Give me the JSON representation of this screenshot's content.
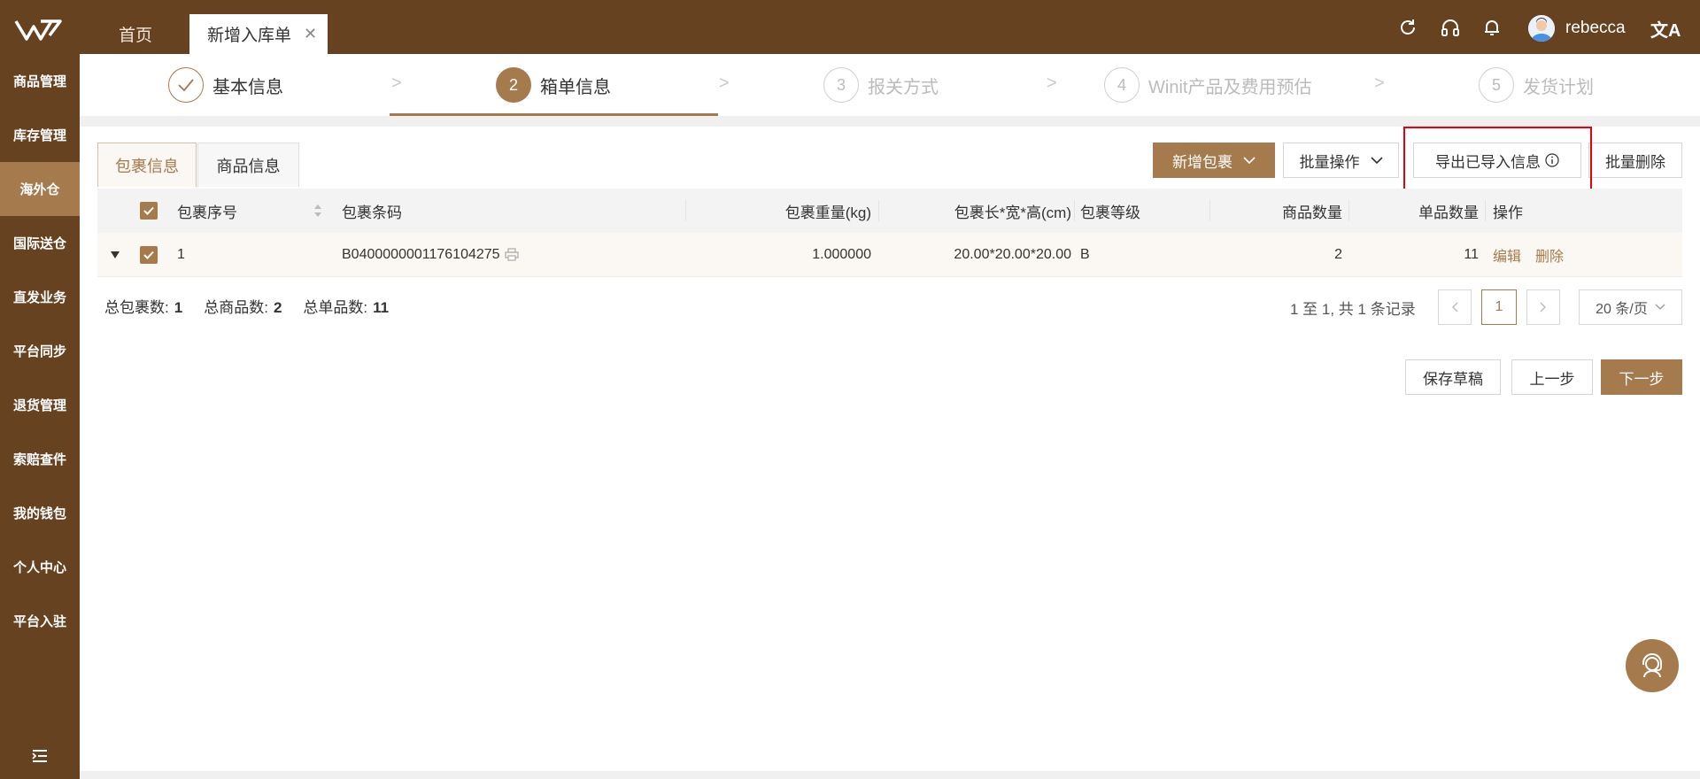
{
  "header": {
    "tabs": [
      {
        "label": "首页"
      },
      {
        "label": "新增入库单"
      }
    ],
    "user_name": "rebecca",
    "colors": {
      "header_bg": "#664220",
      "accent": "#a57b4d"
    }
  },
  "sidebar": {
    "items": [
      {
        "label": "商品管理"
      },
      {
        "label": "库存管理"
      },
      {
        "label": "海外仓"
      },
      {
        "label": "国际送仓"
      },
      {
        "label": "直发业务"
      },
      {
        "label": "平台同步"
      },
      {
        "label": "退货管理"
      },
      {
        "label": "索赔查件"
      },
      {
        "label": "我的钱包"
      },
      {
        "label": "个人中心"
      },
      {
        "label": "平台入驻"
      }
    ],
    "active_index": 2
  },
  "steps": [
    {
      "number": "",
      "label": "基本信息",
      "state": "done"
    },
    {
      "number": "2",
      "label": "箱单信息",
      "state": "active"
    },
    {
      "number": "3",
      "label": "报关方式",
      "state": "pending"
    },
    {
      "number": "4",
      "label": "Winit产品及费用预估",
      "state": "pending"
    },
    {
      "number": "5",
      "label": "发货计划",
      "state": "pending"
    }
  ],
  "subtabs": [
    {
      "label": "包裹信息"
    },
    {
      "label": "商品信息"
    }
  ],
  "toolbar": {
    "add_package": "新增包裹",
    "batch_ops": "批量操作",
    "export_imported": "导出已导入信息",
    "batch_delete": "批量删除"
  },
  "table": {
    "columns": [
      "包裹序号",
      "包裹条码",
      "包裹重量(kg)",
      "包裹长*宽*高(cm)",
      "包裹等级",
      "商品数量",
      "单品数量",
      "操作"
    ],
    "rows": [
      {
        "seq": "1",
        "barcode": "B0400000001176104275",
        "weight": "1.000000",
        "dims": "20.00*20.00*20.00",
        "grade": "B",
        "product_qty": "2",
        "item_qty": "11",
        "actions": [
          "编辑",
          "删除"
        ]
      }
    ]
  },
  "summary": {
    "total_packages_label": "总包裹数:",
    "total_packages": "1",
    "total_products_label": "总商品数:",
    "total_products": "2",
    "total_items_label": "总单品数:",
    "total_items": "11"
  },
  "pagination": {
    "range_text": "1 至 1, 共 1 条记录",
    "current_page": "1",
    "page_size": "20 条/页"
  },
  "footer_buttons": {
    "save_draft": "保存草稿",
    "prev": "上一步",
    "next": "下一步"
  }
}
